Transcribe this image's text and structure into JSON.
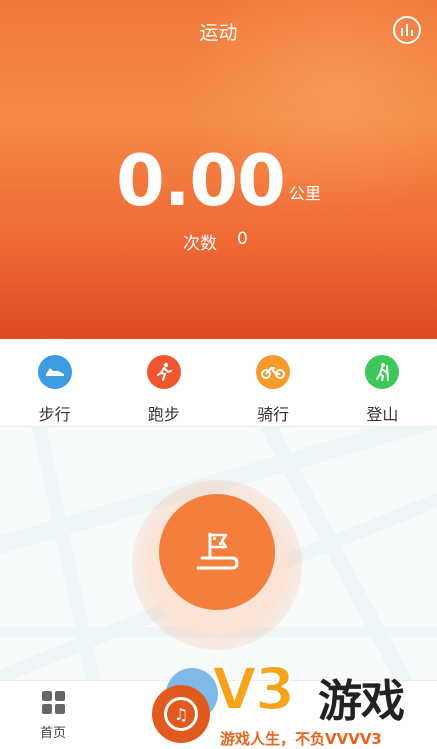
{
  "header": {
    "title": "运动",
    "distance_value": "0.00",
    "distance_unit": "公里",
    "count_label": "次数",
    "count_value": "0"
  },
  "tabs": [
    {
      "label": "步行",
      "icon": "shoe-icon",
      "color": "#3d9be0"
    },
    {
      "label": "跑步",
      "icon": "running-icon",
      "color": "#f25630"
    },
    {
      "label": "骑行",
      "icon": "bicycle-icon",
      "color": "#f79a2c"
    },
    {
      "label": "登山",
      "icon": "hiking-icon",
      "color": "#3fc85a"
    }
  ],
  "start_button": {
    "icon": "flag-start-icon",
    "color": "#f47f3c"
  },
  "bottom_nav": {
    "home_label": "首页",
    "home_icon": "grid-icon"
  },
  "watermark": {
    "brand_mark": "V3",
    "brand_name": "游戏",
    "slogan": "游戏人生，不负VVVV3"
  }
}
